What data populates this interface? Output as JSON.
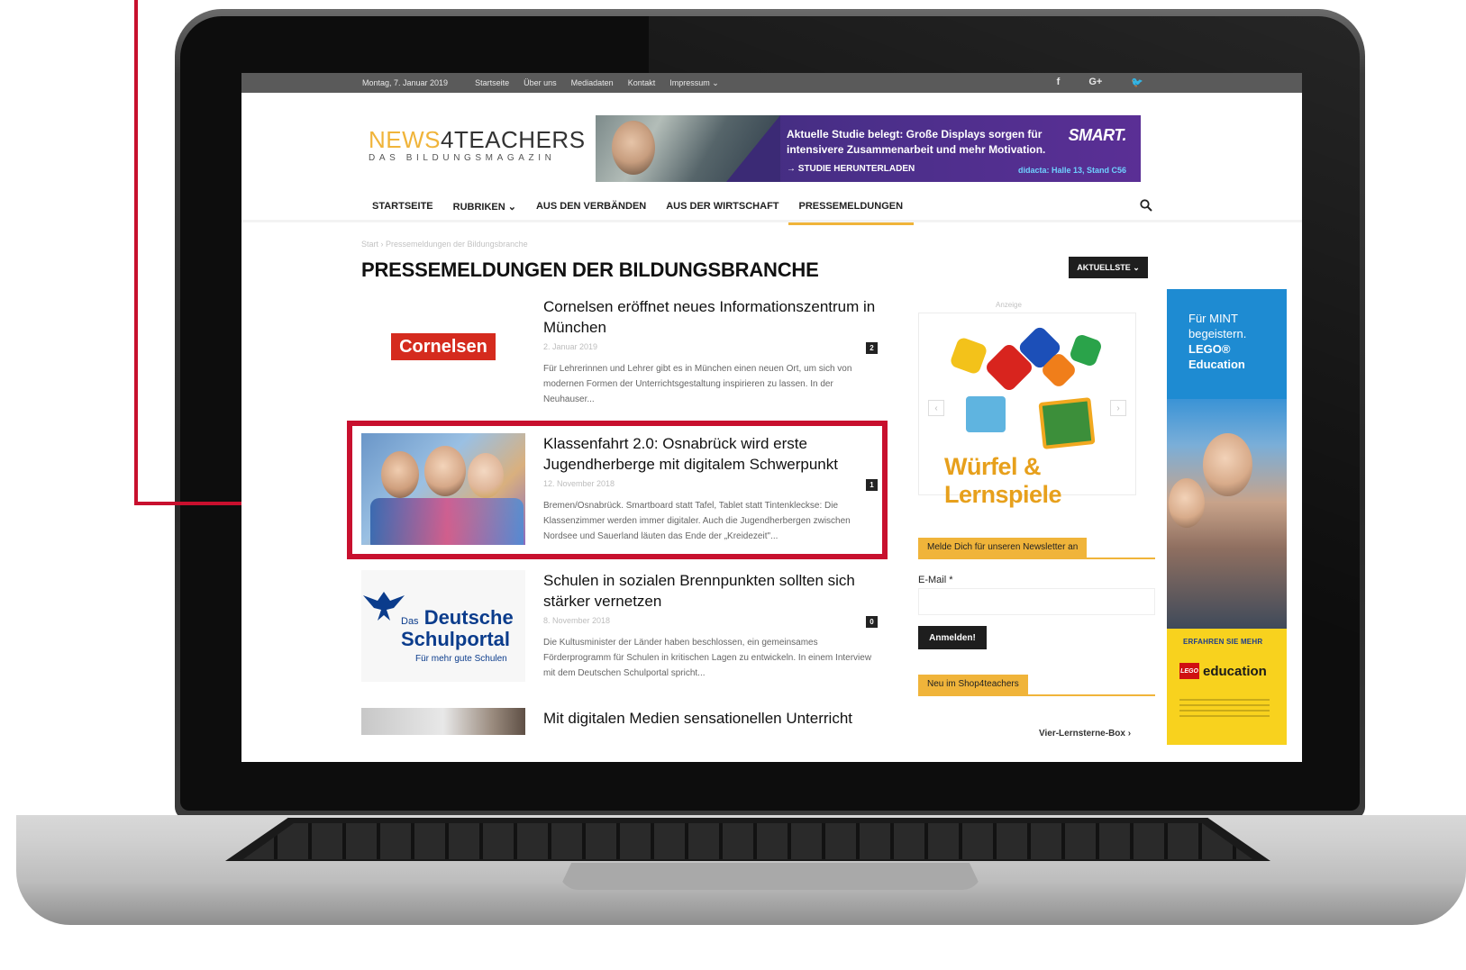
{
  "topbar": {
    "date": "Montag, 7. Januar 2019",
    "links": [
      "Startseite",
      "Über uns",
      "Mediadaten",
      "Kontakt",
      "Impressum ⌄"
    ],
    "social": [
      "f",
      "G+",
      "🐦"
    ]
  },
  "logo": {
    "part1": "NEWS",
    "part2": "4TEACHERS",
    "tagline": "DAS BILDUNGSMAGAZIN"
  },
  "banner": {
    "text": "Aktuelle Studie belegt: Große Displays sorgen für intensivere Zusammenarbeit und mehr Motivation.",
    "cta": "→ STUDIE HERUNTERLADEN",
    "brand": "SMART.",
    "sub": "didacta: Halle 13, Stand C56"
  },
  "nav": {
    "items": [
      "STARTSEITE",
      "RUBRIKEN ⌄",
      "AUS DEN VERBÄNDEN",
      "AUS DER WIRTSCHAFT",
      "PRESSEMELDUNGEN"
    ],
    "active": "PRESSEMELDUNGEN"
  },
  "breadcrumb": "Start  ›  Pressemeldungen der Bildungsbranche",
  "page_title": "PRESSEMELDUNGEN DER BILDUNGSBRANCHE",
  "sort_label": "AKTUELLSTE ⌄",
  "articles": [
    {
      "title": "Cornelsen eröffnet neues Informationszentrum in München",
      "date": "2. Januar 2019",
      "comments": "2",
      "excerpt": "Für Lehrerinnen und Lehrer gibt es in München einen neuen Ort, um sich von modernen Formen der Unterrichtsgestaltung inspirieren zu lassen. In der Neuhauser...",
      "thumb_label": "Cornelsen"
    },
    {
      "title": "Klassenfahrt 2.0: Osnabrück wird erste Jugendherberge mit digitalem Schwerpunkt",
      "date": "12. November 2018",
      "comments": "1",
      "excerpt": "Bremen/Osnabrück. Smartboard statt Tafel, Tablet statt Tintenkleckse: Die Klassenzimmer werden immer digitaler. Auch die Jugendherbergen zwischen Nordsee und Sauerland läuten das Ende der „Kreidezeit\"..."
    },
    {
      "title": "Schulen in sozialen Brennpunkten sollten sich stärker vernetzen",
      "date": "8. November 2018",
      "comments": "0",
      "excerpt": "Die Kultusminister der Länder haben beschlossen, ein gemeinsames Förderprogramm für Schulen in kritischen Lagen zu entwickeln. In einem Interview mit dem Deutschen Schulportal spricht...",
      "thumb_small": "Das",
      "thumb_line1": "Deutsche",
      "thumb_line2": "Schulportal",
      "thumb_line3": "Für mehr gute Schulen"
    },
    {
      "title": "Mit digitalen Medien sensationellen Unterricht"
    }
  ],
  "sidebar": {
    "ad_label": "Anzeige",
    "ad_caption": "Würfel & Lernspiele",
    "ad_prev": "‹",
    "ad_next": "›",
    "newsletter_head": "Melde Dich für unseren Newsletter an",
    "email_label": "E-Mail *",
    "subscribe": "Anmelden!",
    "shop_head": "Neu im Shop4teachers",
    "shop_product": "Vier-Lernsterne-Box ›"
  },
  "lego_ad": {
    "line1": "Für MINT",
    "line2": "begeistern.",
    "line3": "LEGO®",
    "line4": "Education",
    "more": "ERFAHREN SIE MEHR",
    "badge": "LEGO",
    "brand": "education"
  },
  "colors": {
    "accent": "#f0b43a",
    "callout": "#c8102e",
    "topbar": "#5a5a5a",
    "banner": "#4b2f8a",
    "lego_blue": "#1e8bd2",
    "lego_yellow": "#f8d21e"
  }
}
